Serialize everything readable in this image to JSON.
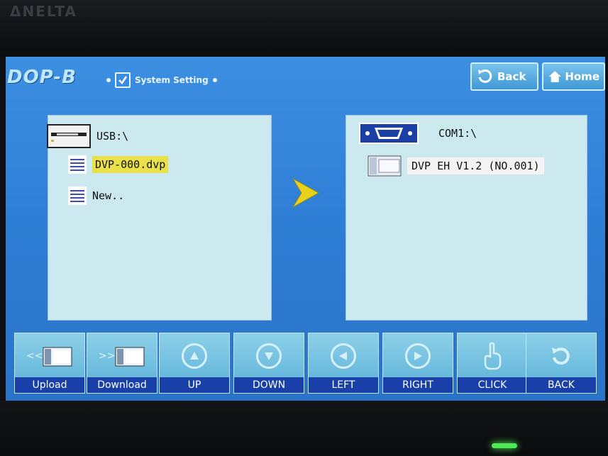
{
  "bezel": {
    "brand": "ΔNELTA"
  },
  "header": {
    "logo": "DOP-B",
    "breadcrumb": "System Setting",
    "back_label": "Back",
    "home_label": "Home"
  },
  "left_panel": {
    "drive_label": "USB:\\",
    "items": [
      {
        "label": "DVP-000.dvp",
        "selected": true
      },
      {
        "label": "New..",
        "selected": false
      }
    ]
  },
  "right_panel": {
    "port_label": "COM1:\\",
    "items": [
      {
        "label": "DVP EH V1.2 (NO.001)",
        "selected": true
      }
    ]
  },
  "toolbar": {
    "buttons": [
      {
        "label": "Upload",
        "icon": "upload-icon"
      },
      {
        "label": "Download",
        "icon": "download-icon"
      },
      {
        "label": "UP",
        "icon": "arrow-up-icon"
      },
      {
        "label": "DOWN",
        "icon": "arrow-down-icon"
      },
      {
        "label": "LEFT",
        "icon": "arrow-left-icon"
      },
      {
        "label": "RIGHT",
        "icon": "arrow-right-icon"
      },
      {
        "label": "CLICK",
        "icon": "hand-pointer-icon"
      },
      {
        "label": "BACK",
        "icon": "undo-icon"
      }
    ]
  },
  "colors": {
    "screen_bg": "#3d8fe2",
    "panel_bg": "#cde9f0",
    "selection_yellow": "#e9e04a",
    "toolbar_caption": "#1840a8",
    "status_led": "#4eea53"
  }
}
